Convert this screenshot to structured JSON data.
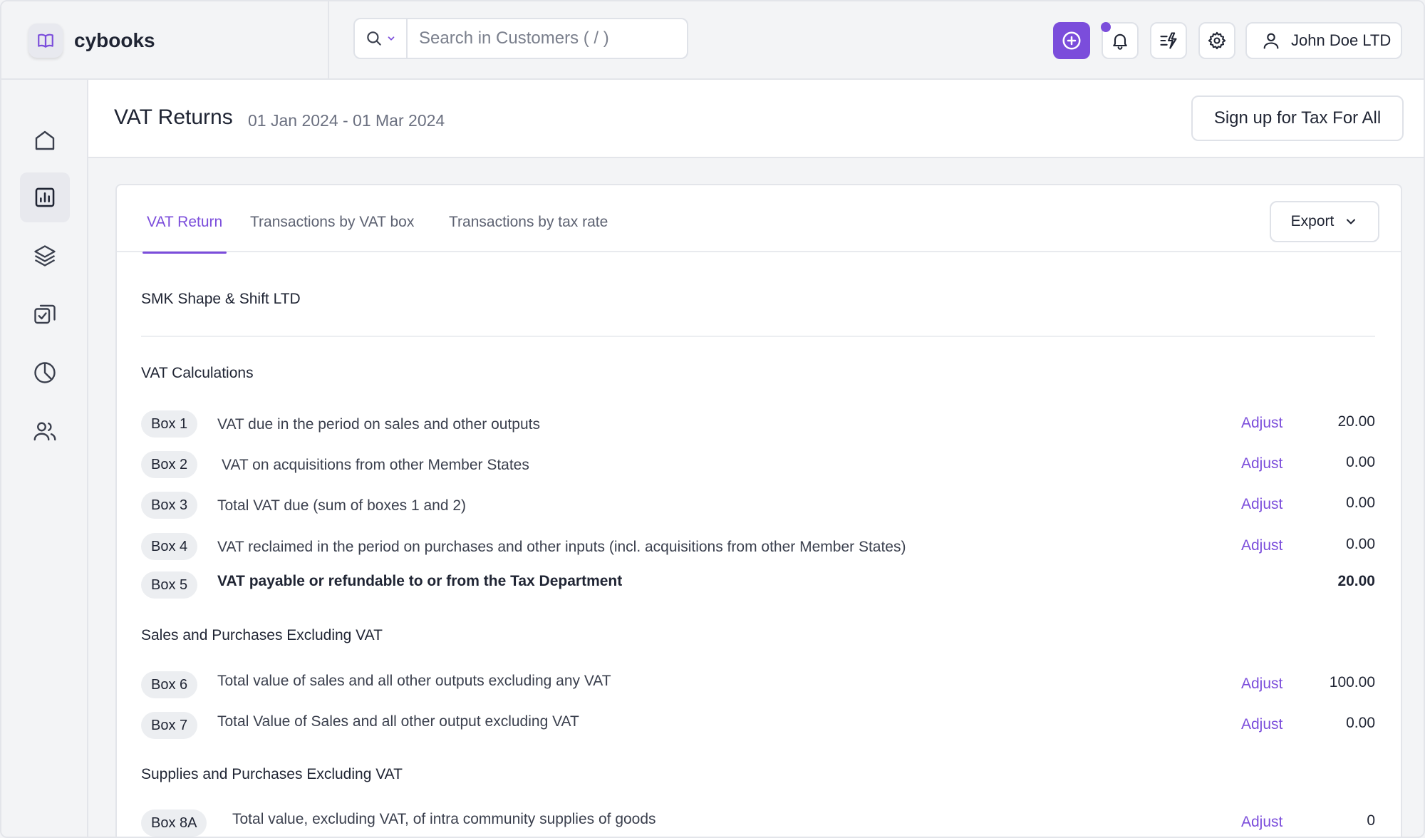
{
  "app": {
    "name": "cybooks"
  },
  "search": {
    "placeholder": "Search in Customers ( / )",
    "value": ""
  },
  "user": {
    "name": "John Doe LTD"
  },
  "header": {
    "title": "VAT Returns",
    "period": "01 Jan 2024 - 01 Mar 2024",
    "signup_label": "Sign up for Tax For All"
  },
  "tabs": [
    {
      "label": "VAT Return",
      "active": true
    },
    {
      "label": "Transactions by VAT box",
      "active": false
    },
    {
      "label": "Transactions by tax rate",
      "active": false
    }
  ],
  "export_label": "Export",
  "company": "SMK Shape & Shift LTD",
  "adjust_label": "Adjust",
  "sections": [
    {
      "title": "VAT Calculations",
      "rows": [
        {
          "box": "Box 1",
          "desc": "VAT due in the period on sales and other outputs",
          "value": "20.00"
        },
        {
          "box": "Box 2",
          "desc": "VAT on acquisitions from other Member States",
          "value": "0.00"
        },
        {
          "box": "Box 3",
          "desc": "Total VAT due (sum of boxes 1 and 2)",
          "value": "0.00"
        },
        {
          "box": "Box 4",
          "desc": "VAT reclaimed in the period on purchases and  other inputs (incl. acquisitions from other Member States)",
          "value": "0.00"
        },
        {
          "box": "Box 5",
          "desc": "VAT payable or refundable to or from the Tax Department",
          "value": "20.00"
        }
      ]
    },
    {
      "title": "Sales and Purchases Excluding VAT",
      "rows": [
        {
          "box": "Box 6",
          "desc": "Total value of sales and all other outputs excluding any VAT",
          "value": "100.00"
        },
        {
          "box": "Box 7",
          "desc": "Total Value of Sales and all other output excluding VAT",
          "value": "0.00"
        }
      ]
    },
    {
      "title": "Supplies and Purchases Excluding VAT",
      "rows": [
        {
          "box": "Box 8A",
          "desc": "Total value, excluding VAT, of intra community supplies of goods",
          "value": "0"
        }
      ]
    }
  ],
  "colors": {
    "accent": "#7b4ddb",
    "border": "#e3e5ea",
    "text": "#1f2433"
  },
  "icons": {
    "logo": "open-book-icon",
    "search": "search-icon",
    "add": "plus-circle-icon",
    "notifications": "bell-icon",
    "quick_actions": "lightning-icon",
    "settings": "gear-icon",
    "user": "user-icon",
    "sidebar": [
      "home-icon",
      "bar-chart-icon",
      "layers-icon",
      "checklist-icon",
      "pie-chart-icon",
      "users-icon"
    ]
  }
}
